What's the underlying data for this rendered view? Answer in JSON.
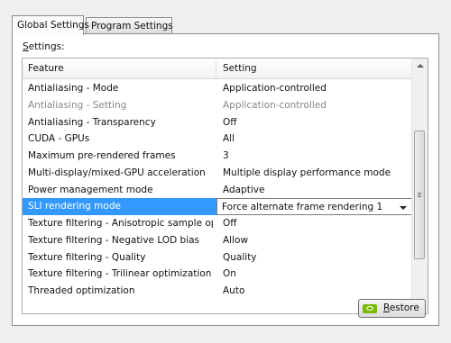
{
  "tabs": [
    {
      "label": "Global Settings",
      "active": true
    },
    {
      "label": "Program Settings",
      "active": false
    }
  ],
  "settings_label": {
    "mnemonic": "S",
    "rest": "ettings:"
  },
  "table": {
    "columns": [
      "Feature",
      "Setting"
    ],
    "rows": [
      {
        "feature": "Antialiasing - Mode",
        "setting": "Application-controlled"
      },
      {
        "feature": "Antialiasing - Setting",
        "setting": "Application-controlled"
      },
      {
        "feature": "Antialiasing - Transparency",
        "setting": "Off"
      },
      {
        "feature": "CUDA - GPUs",
        "setting": "All"
      },
      {
        "feature": "Maximum pre-rendered frames",
        "setting": "3"
      },
      {
        "feature": "Multi-display/mixed-GPU acceleration",
        "setting": "Multiple display performance mode"
      },
      {
        "feature": "Power management mode",
        "setting": "Adaptive"
      },
      {
        "feature": "SLI rendering mode",
        "setting": "Force alternate frame rendering 1"
      },
      {
        "feature": "Texture filtering - Anisotropic sample opti...",
        "setting": "Off"
      },
      {
        "feature": "Texture filtering - Negative LOD bias",
        "setting": "Allow"
      },
      {
        "feature": "Texture filtering - Quality",
        "setting": "Quality"
      },
      {
        "feature": "Texture filtering - Trilinear optimization",
        "setting": "On"
      },
      {
        "feature": "Threaded optimization",
        "setting": "Auto"
      }
    ],
    "disabled_row_index": 1,
    "selected_row_index": 7
  },
  "restore_button": {
    "mnemonic": "R",
    "rest": "estore"
  },
  "icons": {
    "scroll_up": "triangle-up-icon",
    "scroll_down": "triangle-down-icon",
    "dropdown": "chevron-down-icon",
    "restore_logo": "nvidia-logo-icon"
  },
  "colors": {
    "selection": "#3399ff",
    "nvidia_green": "#76b900"
  }
}
